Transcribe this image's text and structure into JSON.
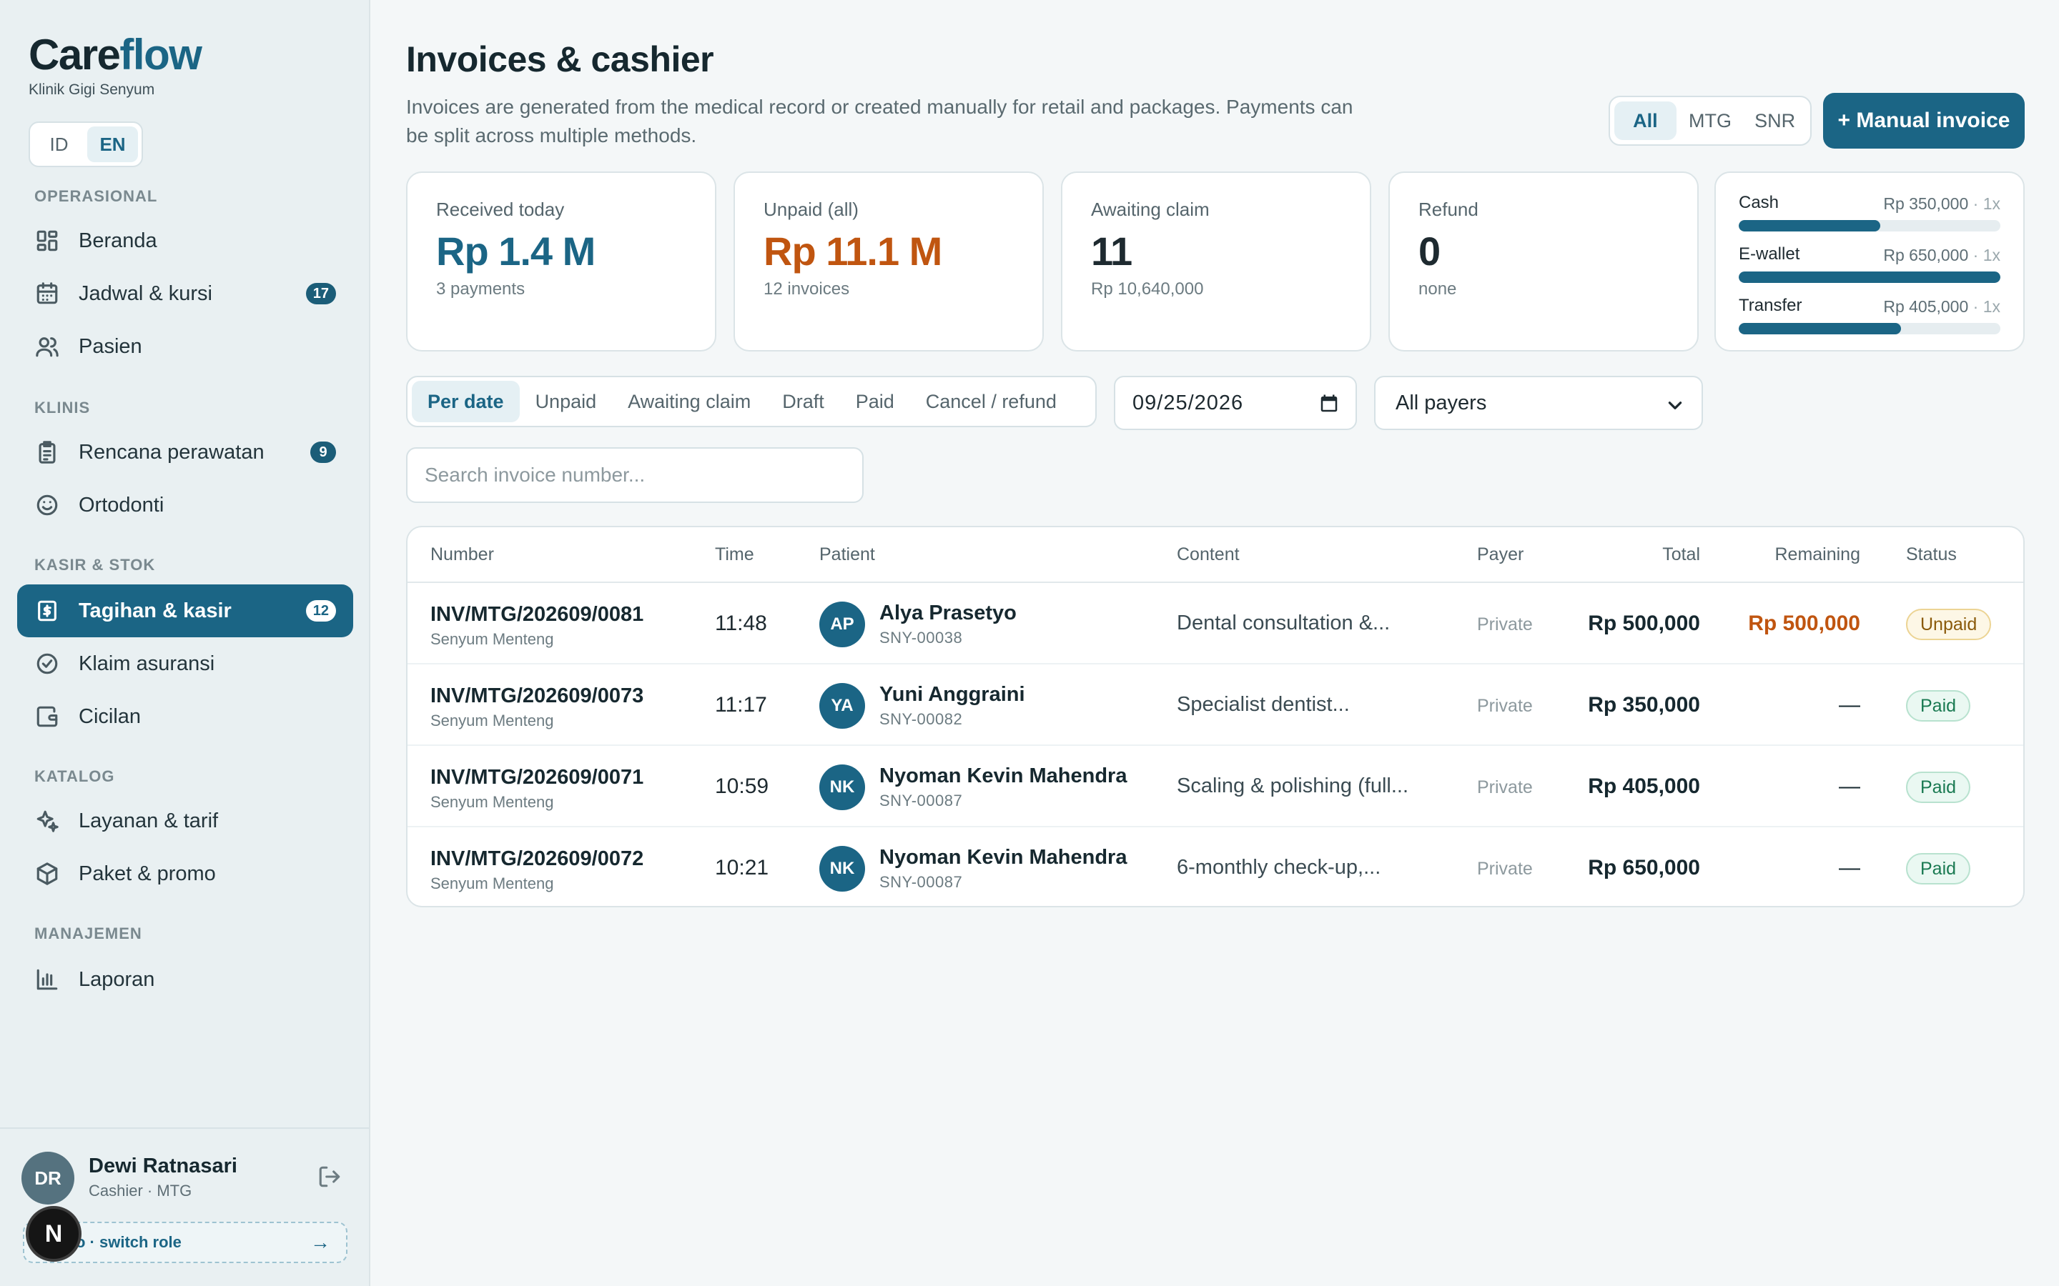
{
  "brand": {
    "name_part1": "Care",
    "name_part2": "flow",
    "clinic": "Klinik Gigi Senyum"
  },
  "language": {
    "options": [
      "ID",
      "EN"
    ],
    "selected": "EN"
  },
  "sidebar": {
    "sections": [
      {
        "title": "OPERASIONAL",
        "items": [
          {
            "label": "Beranda",
            "icon": "dashboard-icon"
          },
          {
            "label": "Jadwal & kursi",
            "icon": "calendar-icon",
            "badge": "17"
          },
          {
            "label": "Pasien",
            "icon": "users-icon"
          }
        ]
      },
      {
        "title": "KLINIS",
        "items": [
          {
            "label": "Rencana perawatan",
            "icon": "clipboard-icon",
            "badge": "9"
          },
          {
            "label": "Ortodonti",
            "icon": "smile-icon"
          }
        ]
      },
      {
        "title": "KASIR & STOK",
        "items": [
          {
            "label": "Tagihan & kasir",
            "icon": "invoice-icon",
            "badge": "12",
            "active": true
          },
          {
            "label": "Klaim asuransi",
            "icon": "check-circle-icon"
          },
          {
            "label": "Cicilan",
            "icon": "wallet-icon"
          }
        ]
      },
      {
        "title": "KATALOG",
        "items": [
          {
            "label": "Layanan & tarif",
            "icon": "sparkles-icon"
          },
          {
            "label": "Paket & promo",
            "icon": "package-icon"
          }
        ]
      },
      {
        "title": "MANAJEMEN",
        "items": [
          {
            "label": "Laporan",
            "icon": "bar-chart-icon"
          }
        ]
      }
    ]
  },
  "user": {
    "initials": "DR",
    "name": "Dewi Ratnasari",
    "role": "Cashier · MTG",
    "switch_label": "o · switch role",
    "switch_arrow": "→",
    "bubble": "N"
  },
  "header": {
    "title": "Invoices & cashier",
    "description": "Invoices are generated from the medical record or created manually for retail and packages. Payments can be split across multiple methods.",
    "branches": [
      "All",
      "MTG",
      "SNR"
    ],
    "branch_selected": "All",
    "manual_invoice_label": "+ Manual invoice"
  },
  "stats": [
    {
      "label": "Received today",
      "value": "Rp 1.4 M",
      "sub": "3 payments",
      "color": "#1b6585"
    },
    {
      "label": "Unpaid (all)",
      "value": "Rp 11.1 M",
      "sub": "12 invoices",
      "color": "#c05510"
    },
    {
      "label": "Awaiting claim",
      "value": "11",
      "sub": "Rp 10,640,000",
      "color": "#16282f"
    },
    {
      "label": "Refund",
      "value": "0",
      "sub": "none",
      "color": "#16282f"
    }
  ],
  "payment_methods": [
    {
      "name": "Cash",
      "amount": "Rp 350,000",
      "count": " · 1x",
      "share": 0.54
    },
    {
      "name": "E-wallet",
      "amount": "Rp 650,000",
      "count": " · 1x",
      "share": 1.0
    },
    {
      "name": "Transfer",
      "amount": "Rp 405,000",
      "count": " · 1x",
      "share": 0.62
    }
  ],
  "filters": {
    "tabs": [
      "Per date",
      "Unpaid",
      "Awaiting claim",
      "Draft",
      "Paid",
      "Cancel / refund"
    ],
    "selected": "Per date",
    "date": "09/25/2026",
    "payer": "All payers",
    "search_placeholder": "Search invoice number..."
  },
  "table": {
    "headers": {
      "number": "Number",
      "time": "Time",
      "patient": "Patient",
      "content": "Content",
      "payer": "Payer",
      "total": "Total",
      "remaining": "Remaining",
      "status": "Status"
    },
    "rows": [
      {
        "number": "INV/MTG/202609/0081",
        "branch": "Senyum Menteng",
        "time": "11:48",
        "initials": "AP",
        "patient": "Alya Prasetyo",
        "patient_id": "SNY-00038",
        "content": "Dental consultation &...",
        "payer": "Private",
        "total": "Rp 500,000",
        "remaining": "Rp 500,000",
        "status": "Unpaid"
      },
      {
        "number": "INV/MTG/202609/0073",
        "branch": "Senyum Menteng",
        "time": "11:17",
        "initials": "YA",
        "patient": "Yuni Anggraini",
        "patient_id": "SNY-00082",
        "content": "Specialist dentist...",
        "payer": "Private",
        "total": "Rp 350,000",
        "remaining": "—",
        "status": "Paid"
      },
      {
        "number": "INV/MTG/202609/0071",
        "branch": "Senyum Menteng",
        "time": "10:59",
        "initials": "NK",
        "patient": "Nyoman Kevin Mahendra",
        "patient_id": "SNY-00087",
        "content": "Scaling & polishing (full...",
        "payer": "Private",
        "total": "Rp 405,000",
        "remaining": "—",
        "status": "Paid"
      },
      {
        "number": "INV/MTG/202609/0072",
        "branch": "Senyum Menteng",
        "time": "10:21",
        "initials": "NK",
        "patient": "Nyoman Kevin Mahendra",
        "patient_id": "SNY-00087",
        "content": "6-monthly check-up,...",
        "payer": "Private",
        "total": "Rp 650,000",
        "remaining": "—",
        "status": "Paid"
      }
    ]
  }
}
